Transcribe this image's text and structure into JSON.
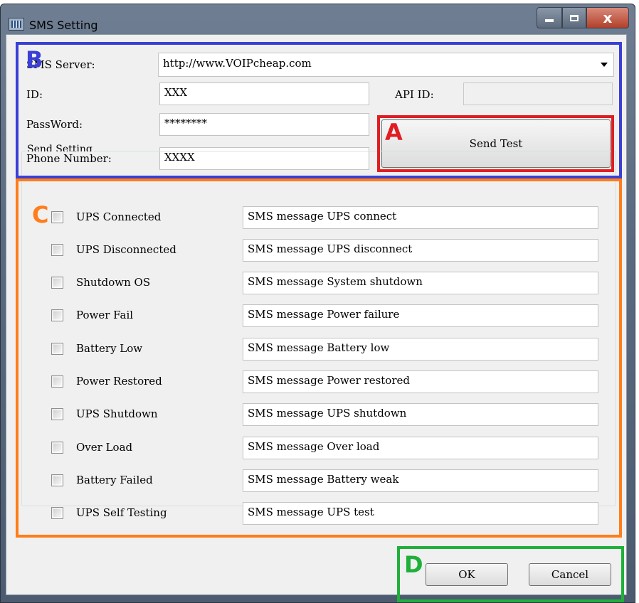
{
  "window": {
    "title": "SMS Setting",
    "close_glyph": "x"
  },
  "server": {
    "label": "SMS Server:",
    "value": "http://www.VOIPcheap.com"
  },
  "id": {
    "label": "ID:",
    "value": "XXX"
  },
  "api_id": {
    "label": "API ID:",
    "value": ""
  },
  "password": {
    "label": "PassWord:",
    "value": "********"
  },
  "phone": {
    "label": "Phone Number:",
    "value": "XXXX"
  },
  "send_test_label": "Send Test",
  "send_setting": {
    "group_title": "Send Setting",
    "rows": [
      {
        "label": "UPS Connected",
        "message": "SMS message UPS connect",
        "checked": false
      },
      {
        "label": "UPS Disconnected",
        "message": "SMS message UPS disconnect",
        "checked": false
      },
      {
        "label": "Shutdown OS",
        "message": "SMS message System shutdown",
        "checked": false
      },
      {
        "label": "Power Fail",
        "message": "SMS message Power failure",
        "checked": false
      },
      {
        "label": "Battery Low",
        "message": "SMS message Battery low",
        "checked": false
      },
      {
        "label": "Power Restored",
        "message": "SMS message Power restored",
        "checked": false
      },
      {
        "label": "UPS Shutdown",
        "message": "SMS message UPS shutdown",
        "checked": false
      },
      {
        "label": "Over Load",
        "message": "SMS message Over load",
        "checked": false
      },
      {
        "label": "Battery Failed",
        "message": "SMS message Battery weak",
        "checked": false
      },
      {
        "label": "UPS Self Testing",
        "message": "SMS message UPS test",
        "checked": false
      }
    ]
  },
  "buttons": {
    "ok": "OK",
    "cancel": "Cancel"
  },
  "annotations": {
    "a": {
      "letter": "A",
      "color": "#e11d22"
    },
    "b": {
      "letter": "B",
      "color": "#3a3fd6"
    },
    "c": {
      "letter": "C",
      "color": "#ff7d1a"
    },
    "d": {
      "letter": "D",
      "color": "#1fb03a"
    }
  }
}
